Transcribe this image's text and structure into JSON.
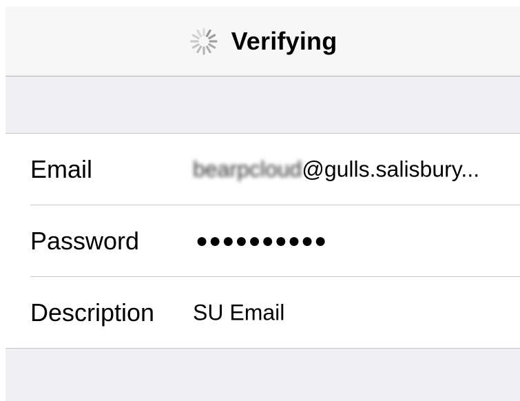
{
  "navbar": {
    "title": "Verifying",
    "spinner_icon": "activity-spinner-icon"
  },
  "form": {
    "rows": [
      {
        "label": "Email",
        "value_blurred": "bearpcloud",
        "value_suffix": "@gulls.salisbury..."
      },
      {
        "label": "Password",
        "value": "●●●●●●●●●●"
      },
      {
        "label": "Description",
        "value": "SU Email"
      }
    ]
  },
  "colors": {
    "navbar_bg": "#f7f7f7",
    "grouped_bg": "#efeff4",
    "cell_bg": "#ffffff",
    "separator": "#c8c7cc",
    "text": "#000000"
  }
}
